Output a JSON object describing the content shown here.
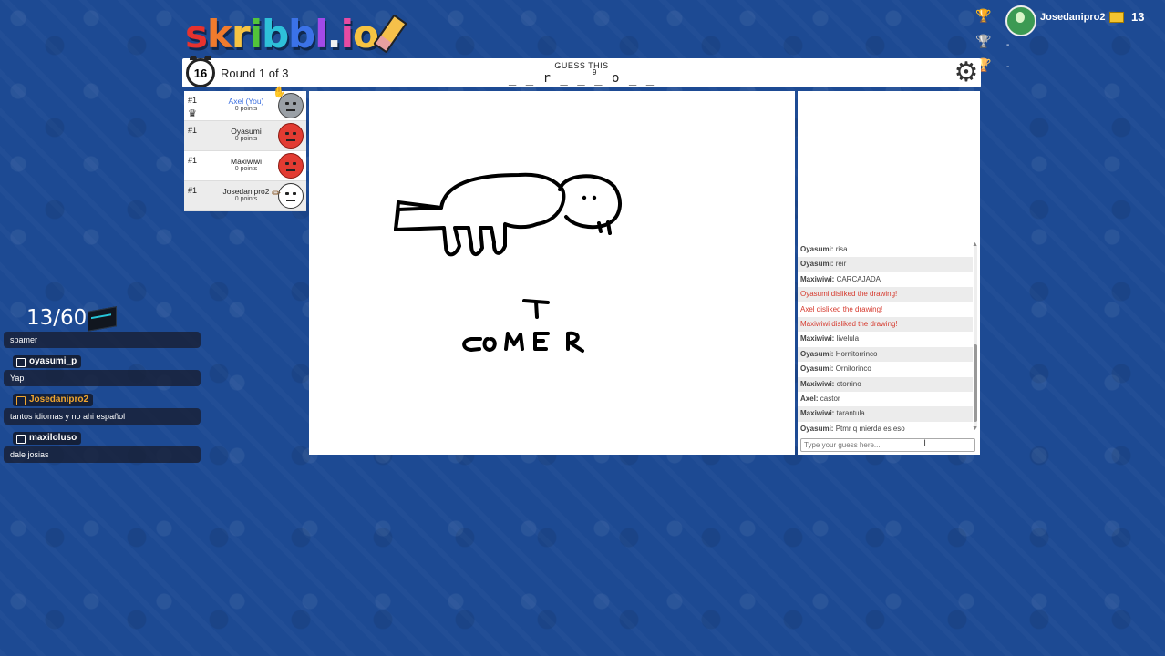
{
  "logo": {
    "letters": [
      "s",
      "k",
      "r",
      "i",
      "b",
      "b",
      "l",
      ".",
      "i",
      "o"
    ],
    "colors": [
      "#e6322e",
      "#f07b2d",
      "#f6c342",
      "#52c43a",
      "#2ec1d9",
      "#3b72e8",
      "#a24ae8",
      "#f0f0f0",
      "#e64ba2",
      "#f6c342"
    ]
  },
  "header": {
    "timer": "16",
    "round_label": "Round 1 of 3",
    "guess_label": "GUESS THIS",
    "word_hint": "_ _ r _ _ _ o _ _",
    "word_length": "9"
  },
  "players": [
    {
      "rank": "#1",
      "name": "Axel (You)",
      "points": "0 points",
      "avatar": "gray",
      "you": true
    },
    {
      "rank": "#1",
      "name": "Oyasumi",
      "points": "0 points",
      "avatar": "red"
    },
    {
      "rank": "#1",
      "name": "Maxiwiwi",
      "points": "0 points",
      "avatar": "red"
    },
    {
      "rank": "#1",
      "name": "Josedanipro2",
      "points": "0 points",
      "avatar": "white"
    }
  ],
  "canvas_text": "COMER",
  "chat": {
    "messages": [
      {
        "author": "Oyasumi",
        "text": "risa"
      },
      {
        "author": "Oyasumi",
        "text": "reir"
      },
      {
        "author": "Maxiwiwi",
        "text": "CARCAJADA"
      },
      {
        "system": true,
        "text": "Oyasumi disliked the drawing!"
      },
      {
        "system": true,
        "text": "Axel disliked the drawing!"
      },
      {
        "system": true,
        "text": "Maxiwiwi disliked the drawing!"
      },
      {
        "author": "Maxiwiwi",
        "text": "livelula"
      },
      {
        "author": "Oyasumi",
        "text": "Hornitorrinco"
      },
      {
        "author": "Oyasumi",
        "text": "Ornitorinco"
      },
      {
        "author": "Maxiwiwi",
        "text": "otorrino"
      },
      {
        "author": "Axel",
        "text": "castor"
      },
      {
        "author": "Maxiwiwi",
        "text": "tarantula"
      },
      {
        "author": "Oyasumi",
        "text": "Ptmr q mierda es eso"
      }
    ],
    "input_placeholder": "Type your guess here..."
  },
  "top_right": {
    "username": "Josedanipro2",
    "coins": "13",
    "rank2": "-",
    "rank3": "-",
    "trophy_colors": [
      "#f4c430",
      "#c0c0c0",
      "#d9822b"
    ]
  },
  "stream": {
    "sub_count": "13/60",
    "chat": [
      {
        "text": "spamer"
      },
      {
        "user": "oyasumi_p",
        "user_color": "#ffffff",
        "text": "Yap"
      },
      {
        "user": "Josedanipro2",
        "user_color": "#f0a630",
        "text": "tantos idiomas y no ahi español"
      },
      {
        "user": "maxiloluso",
        "user_color": "#ffffff",
        "text": "dale josias"
      }
    ]
  }
}
